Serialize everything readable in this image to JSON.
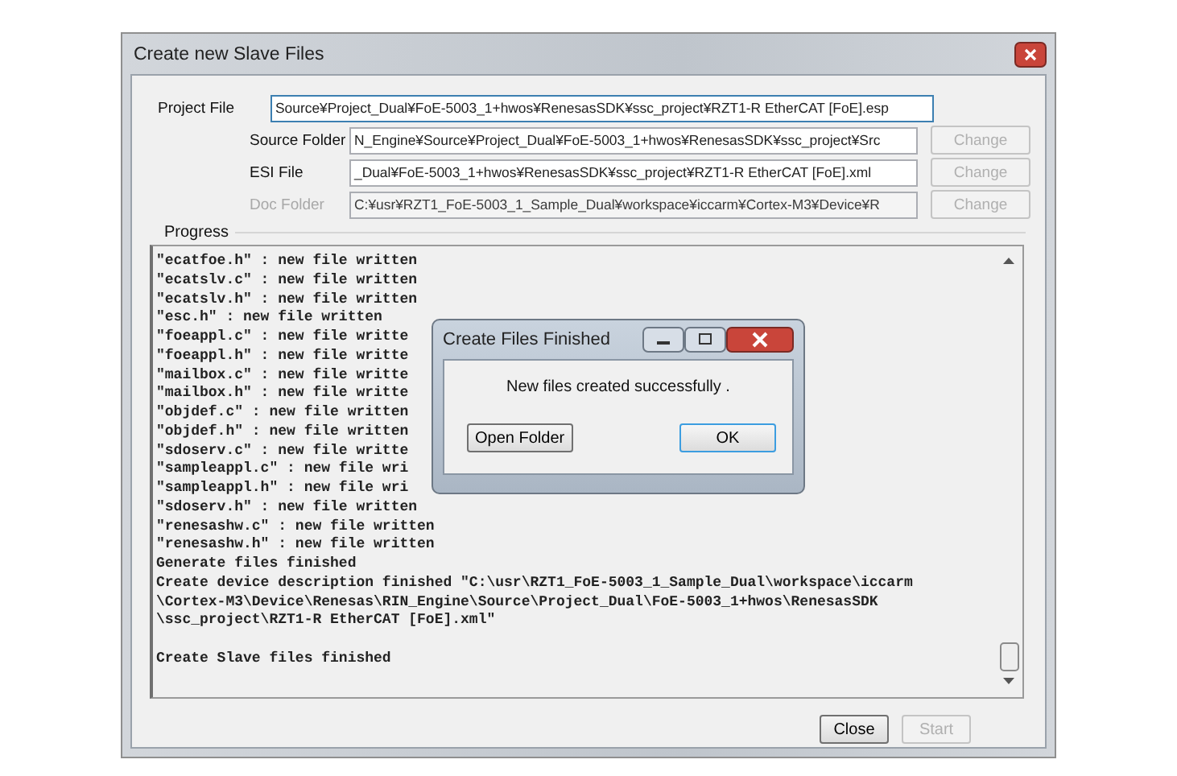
{
  "window": {
    "title": "Create new Slave Files"
  },
  "paths": [
    {
      "kind": "main",
      "label": "Project File",
      "value": "Source¥Project_Dual¥FoE-5003_1+hwos¥RenesasSDK¥ssc_project¥RZT1-R EtherCAT [FoE].esp",
      "disabled": false,
      "focused": true
    },
    {
      "kind": "sub",
      "label": "Source Folder",
      "value": "N_Engine¥Source¥Project_Dual¥FoE-5003_1+hwos¥RenesasSDK¥ssc_project¥Src",
      "disabled": false,
      "focused": false,
      "button": {
        "label": "Change",
        "disabled": true
      }
    },
    {
      "kind": "sub",
      "label": "ESI File",
      "value": "_Dual¥FoE-5003_1+hwos¥RenesasSDK¥ssc_project¥RZT1-R EtherCAT [FoE].xml",
      "disabled": false,
      "focused": false,
      "button": {
        "label": "Change",
        "disabled": true
      }
    },
    {
      "kind": "sub",
      "label": "Doc Folder",
      "value": "C:¥usr¥RZT1_FoE-5003_1_Sample_Dual¥workspace¥iccarm¥Cortex-M3¥Device¥R",
      "disabled": true,
      "focused": false,
      "button": {
        "label": "Change",
        "disabled": true
      }
    }
  ],
  "progress": {
    "label": "Progress",
    "lines": [
      "\"ecatfoe.h\" : new file written",
      "\"ecatslv.c\" : new file written",
      "\"ecatslv.h\" : new file written",
      "\"esc.h\" : new file written",
      "\"foeappl.c\" : new file writte",
      "\"foeappl.h\" : new file writte",
      "\"mailbox.c\" : new file writte",
      "\"mailbox.h\" : new file writte",
      "\"objdef.c\" : new file written",
      "\"objdef.h\" : new file written",
      "\"sdoserv.c\" : new file writte",
      "\"sampleappl.c\" : new file wri",
      "\"sampleappl.h\" : new file wri",
      "\"sdoserv.h\" : new file written",
      "\"renesashw.c\" : new file written",
      "\"renesashw.h\" : new file written",
      "Generate files finished",
      "Create device description finished \"C:\\usr\\RZT1_FoE-5003_1_Sample_Dual\\workspace\\iccarm",
      "\\Cortex-M3\\Device\\Renesas\\RIN_Engine\\Source\\Project_Dual\\FoE-5003_1+hwos\\RenesasSDK",
      "\\ssc_project\\RZT1-R EtherCAT [FoE].xml\""
    ],
    "final_line": "Create Slave files finished"
  },
  "buttons": [
    {
      "label": "Close",
      "disabled": false
    },
    {
      "label": "Start",
      "disabled": true
    }
  ],
  "dialog": {
    "title": "Create Files Finished",
    "message": "New files created successfully .",
    "buttons": [
      {
        "label": "Open Folder",
        "default": false
      },
      {
        "label": "OK",
        "default": true
      }
    ]
  }
}
